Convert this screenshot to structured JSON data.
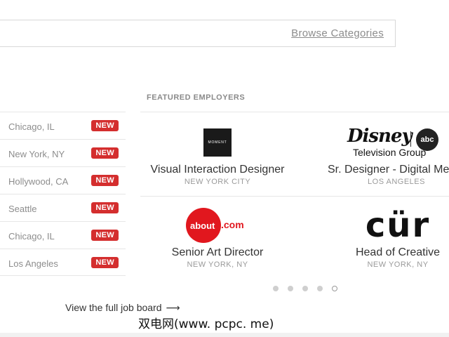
{
  "search": {
    "browse_label": "Browse Categories"
  },
  "featured": {
    "title": "FEATURED EMPLOYERS",
    "cards": [
      {
        "role": "Visual Interaction Designer",
        "location": "NEW YORK CITY",
        "logo_text": "MOMENT"
      },
      {
        "role": "Sr. Designer - Digital Me",
        "location": "LOS ANGELES",
        "logo_text": "Disney",
        "logo_badge": "abc",
        "logo_sub": "Television Group"
      },
      {
        "role": "Senior Art Director",
        "location": "NEW YORK, NY",
        "logo_text": "about",
        "logo_suffix": ".com"
      },
      {
        "role": "Head of Creative",
        "location": "NEW YORK, NY",
        "logo_text": "cür"
      }
    ]
  },
  "jobs": {
    "badge": "NEW",
    "items": [
      {
        "location": "Chicago, IL"
      },
      {
        "location": "New York, NY"
      },
      {
        "location": "Hollywood, CA"
      },
      {
        "location": "Seattle"
      },
      {
        "location": "Chicago, IL"
      },
      {
        "location": "Los Angeles"
      }
    ]
  },
  "carousel": {
    "pages": 5,
    "active_page": 5
  },
  "footer": {
    "full_board_label": "View the full job board",
    "arrow": "⟶"
  },
  "watermark": "双电网(www. pcpc. me)",
  "colors": {
    "badge": "#d42e2e",
    "about_red": "#e1171e"
  }
}
